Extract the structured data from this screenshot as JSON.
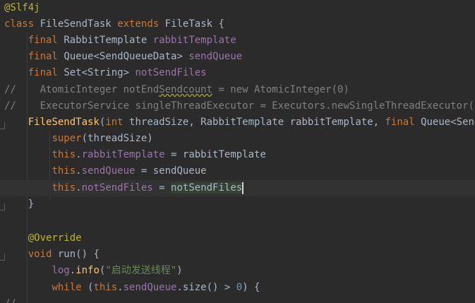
{
  "code": {
    "l1_annotation": "@Slf4j",
    "l2_kw_class": "class",
    "l2_classname": "FileSendTask",
    "l2_kw_extends": "extends",
    "l2_super": "FileTask {",
    "l3_final": "final",
    "l3_type": "RabbitTemplate",
    "l3_field": "rabbitTemplate",
    "l4_final": "final",
    "l4_type": "Queue<SendQueueData>",
    "l4_field": "sendQueue",
    "l5_final": "final",
    "l5_type": "Set<String>",
    "l5_field": "notSendFiles",
    "l6_comment_marker": "//",
    "l6_comment_a": "AtomicInteger notEnd",
    "l6_comment_b": "Sendcount",
    "l6_comment_c": " = new AtomicInteger(0)",
    "l7_comment_marker": "//",
    "l7_comment": "ExecutorService singleThreadExecutor = Executors.newSingleThreadExecutor()",
    "l8_ctor": "FileSendTask",
    "l8_open": "(",
    "l8_int": "int",
    "l8_p1": " threadSize, RabbitTemplate rabbitTemplate, ",
    "l8_final": "final",
    "l8_p2": " Queue<SendQueu",
    "l9_super": "super",
    "l9_args": "(threadSize)",
    "l10_this": "this",
    "l10_dot": ".",
    "l10_field": "rabbitTemplate",
    "l10_rest": " = rabbitTemplate",
    "l11_this": "this",
    "l11_dot": ".",
    "l11_field": "sendQueue",
    "l11_rest": " = sendQueue",
    "l12_this": "this",
    "l12_dot": ".",
    "l12_field": "notSendFiles",
    "l12_eq": " = ",
    "l12_value": "notSendFiles",
    "l13_close": "}",
    "l15_override": "@Override",
    "l16_void": "void",
    "l16_rest": " run() {",
    "l17_log": "log",
    "l17_dot": ".",
    "l17_method": "info",
    "l17_open": "(",
    "l17_str": "\"启动发送线程\"",
    "l17_close": ")",
    "l18_while": "while",
    "l18_a": " (",
    "l18_this": "this",
    "l18_dot": ".",
    "l18_field": "sendQueue",
    "l18_b": ".size() > ",
    "l18_num": "0",
    "l18_c": ") {",
    "l19_comment_marker": "//"
  }
}
